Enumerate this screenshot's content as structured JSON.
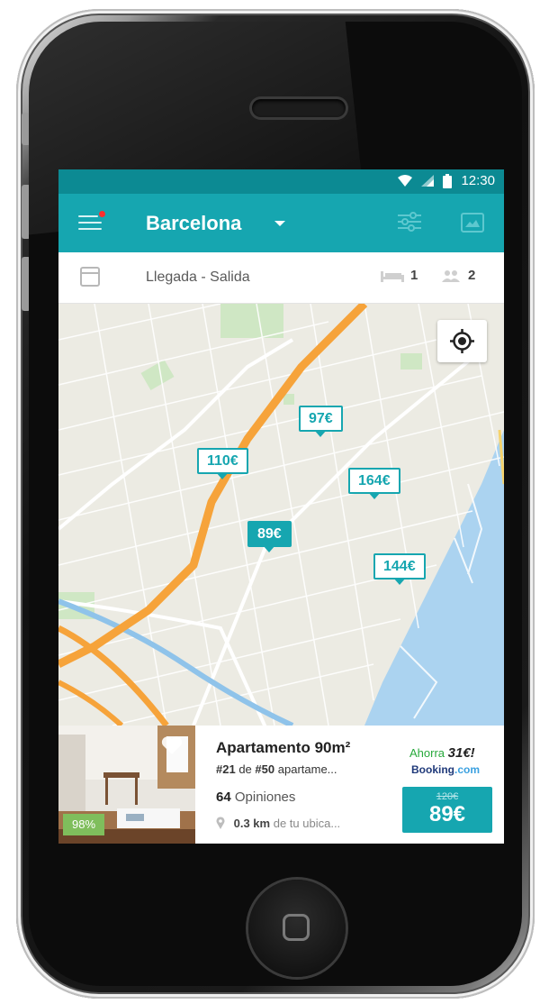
{
  "status": {
    "time": "12:30"
  },
  "appbar": {
    "city": "Barcelona"
  },
  "datebar": {
    "dates": "Llegada - Salida",
    "beds": "1",
    "guests": "2"
  },
  "map": {
    "pins": [
      {
        "price": "97€",
        "active": false
      },
      {
        "price": "110€",
        "active": false
      },
      {
        "price": "164€",
        "active": false
      },
      {
        "price": "89€",
        "active": true
      },
      {
        "price": "144€",
        "active": false
      }
    ]
  },
  "card": {
    "score": "98%",
    "title": "Apartamento 90m²",
    "rank_num": "#21",
    "rank_of": "de",
    "rank_total": "#50",
    "rank_suffix": "apartame...",
    "reviews_count": "64",
    "reviews_label": "Opiniones",
    "distance": "0.3 km",
    "distance_suffix": "de tu ubica...",
    "save_label": "Ahorra",
    "save_amount": "31€!",
    "provider_main": "Booking",
    "provider_tld": ".com",
    "old_price": "120€",
    "price": "89€"
  },
  "colors": {
    "accent": "#16a6b0",
    "statusbar": "#0c8a93",
    "score": "#7fbe5c"
  },
  "icons": [
    "wifi-icon",
    "signal-icon",
    "battery-icon",
    "menu-icon",
    "dropdown-caret-icon",
    "filter-icon",
    "map-view-icon",
    "calendar-icon",
    "bed-icon",
    "guests-icon",
    "my-location-icon",
    "heart-icon",
    "location-pin-icon"
  ]
}
